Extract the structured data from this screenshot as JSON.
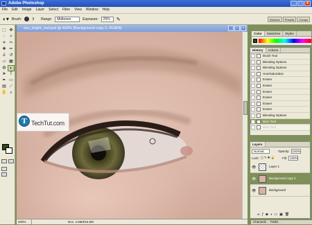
{
  "app": {
    "title": "Adobe Photoshop"
  },
  "menu": [
    "File",
    "Edit",
    "Image",
    "Layer",
    "Select",
    "Filter",
    "View",
    "Window",
    "Help"
  ],
  "options": {
    "brush_label": "Brush:",
    "brush_size": "3",
    "range_label": "Range:",
    "range_value": "Midtones",
    "exposure_label": "Exposure:",
    "exposure_value": "25%",
    "well_tabs": [
      "Brushes",
      "Presets",
      "Comps"
    ]
  },
  "document": {
    "title": "eye_bright_red.psd @ 400% (Background copy 2, RGB/8)",
    "zoom": "400%",
    "doc_size": "Doc: 4.65M/16.8M"
  },
  "watermark": {
    "text": "TechTut.com",
    "logo_letter": "T"
  },
  "color_panel": {
    "tabs": [
      "Color",
      "Swatches",
      "Styles"
    ]
  },
  "history_panel": {
    "tabs": [
      "History",
      "Actions"
    ],
    "items": [
      {
        "label": "Brush Tool",
        "state": "normal"
      },
      {
        "label": "Blending Options",
        "state": "normal"
      },
      {
        "label": "Blending Options",
        "state": "normal"
      },
      {
        "label": "Hue/Saturation",
        "state": "normal"
      },
      {
        "label": "Eraser",
        "state": "normal"
      },
      {
        "label": "Eraser",
        "state": "normal"
      },
      {
        "label": "Eraser",
        "state": "normal"
      },
      {
        "label": "Eraser",
        "state": "normal"
      },
      {
        "label": "Eraser",
        "state": "normal"
      },
      {
        "label": "Eraser",
        "state": "normal"
      },
      {
        "label": "Blending Options",
        "state": "normal"
      },
      {
        "label": "Burn Tool",
        "state": "selected"
      },
      {
        "label": "Burn Tool",
        "state": "dim"
      }
    ]
  },
  "layers_panel": {
    "tabs": [
      "Layers"
    ],
    "blend_mode": "Normal",
    "opacity_label": "Opacity:",
    "opacity_value": "100%",
    "lock_label": "Lock:",
    "fill_label": "Fill:",
    "fill_value": "100%",
    "layers": [
      {
        "name": "Layer 1",
        "selected": false
      },
      {
        "name": "Background copy 2",
        "selected": true
      },
      {
        "name": "Background",
        "selected": false
      }
    ]
  },
  "bottom_tabs": [
    "Channels",
    "Paths"
  ]
}
